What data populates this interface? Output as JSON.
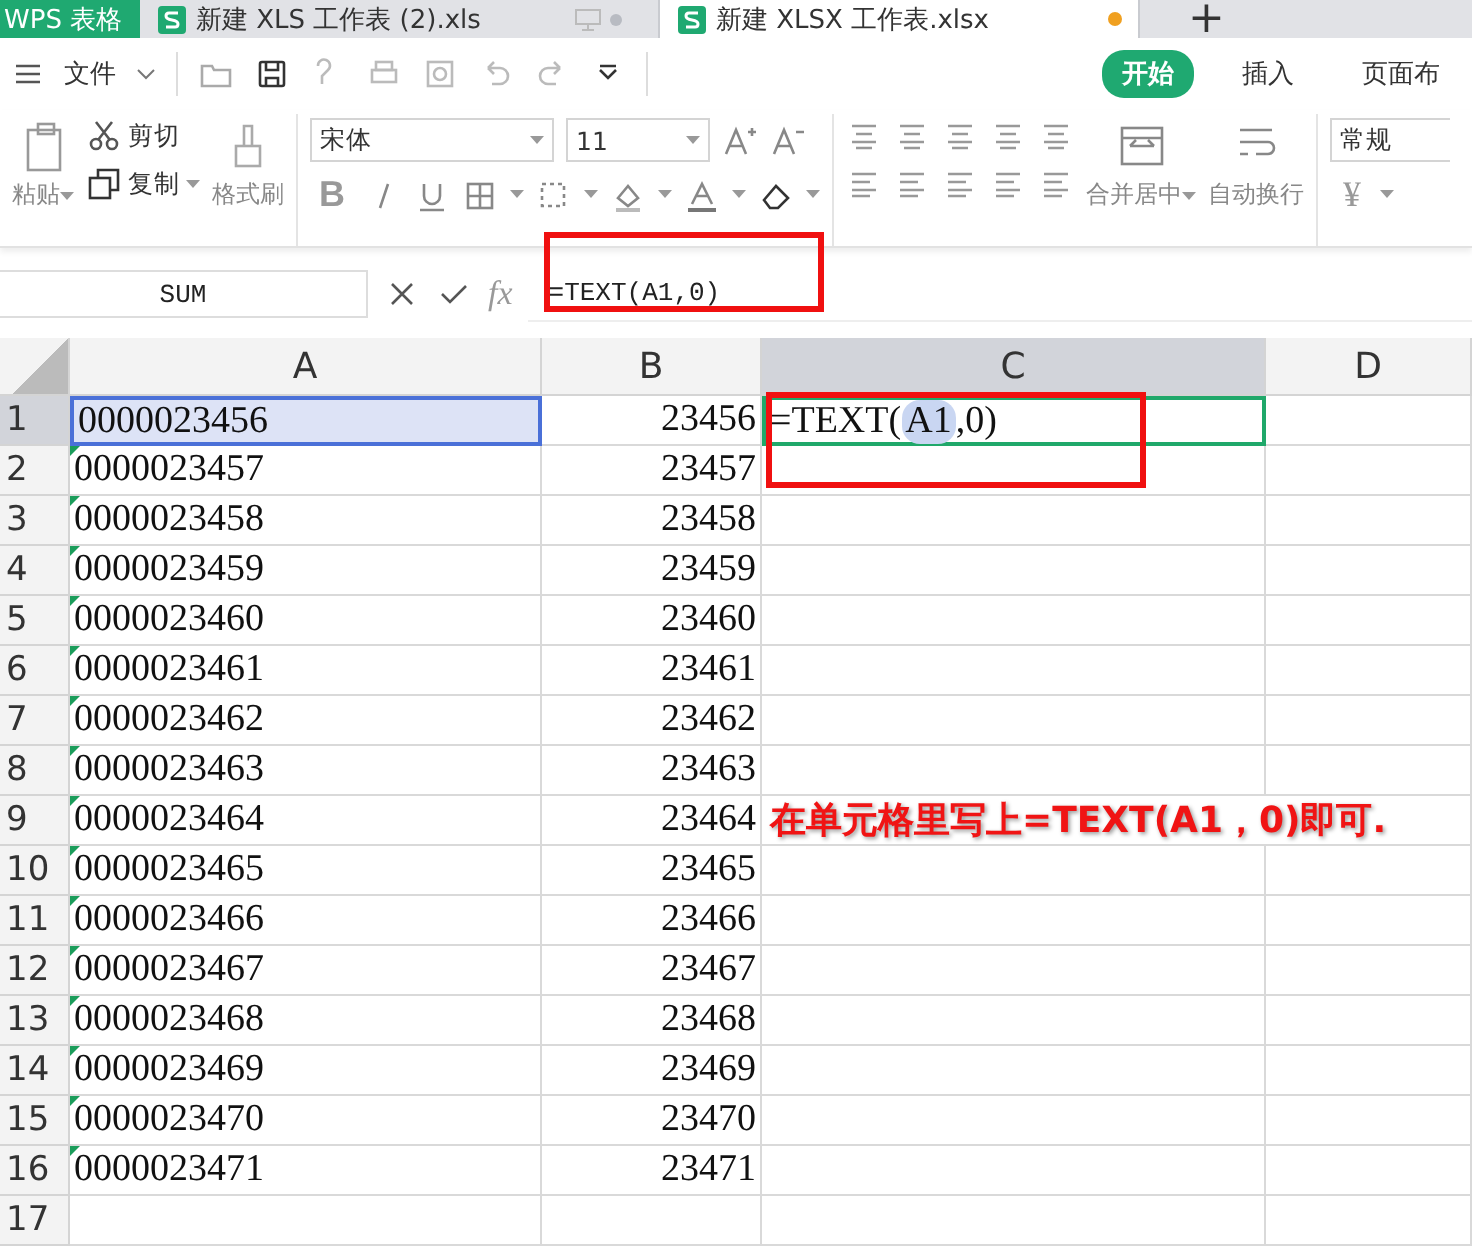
{
  "tabs": [
    {
      "label": "WPS 表格",
      "kind": "app",
      "selected": false
    },
    {
      "label": "新建 XLS 工作表 (2).xls",
      "kind": "doc",
      "selected": false,
      "unsaved": false
    },
    {
      "label": "新建 XLSX 工作表.xlsx",
      "kind": "doc",
      "selected": true,
      "unsaved": true
    },
    {
      "label": "+",
      "kind": "new"
    }
  ],
  "menu": {
    "file": "文件",
    "ribbon_tabs": [
      {
        "label": "开始",
        "selected": true
      },
      {
        "label": "插入",
        "selected": false
      },
      {
        "label": "页面布",
        "selected": false
      }
    ]
  },
  "ribbon": {
    "paste": "粘贴",
    "cut": "剪切",
    "copy": "复制",
    "format_painter": "格式刷",
    "font_name": "宋体",
    "font_size": "11",
    "merge": "合并居中",
    "wrap": "自动换行",
    "number_format": "常规",
    "currency": "¥",
    "bold": "B"
  },
  "formula_bar": {
    "name_box": "SUM",
    "function_label": "fx",
    "formula": "=TEXT(A1,0)"
  },
  "sheet": {
    "columns": [
      {
        "label": "A",
        "selected": false
      },
      {
        "label": "B",
        "selected": false
      },
      {
        "label": "C",
        "selected": true
      },
      {
        "label": "D",
        "selected": false
      }
    ],
    "rows": [
      {
        "n": "1",
        "a": "0000023456",
        "b": "23456",
        "flag": false,
        "selected": true
      },
      {
        "n": "2",
        "a": "0000023457",
        "b": "23457",
        "flag": true,
        "selected": false
      },
      {
        "n": "3",
        "a": "0000023458",
        "b": "23458",
        "flag": true,
        "selected": false
      },
      {
        "n": "4",
        "a": "0000023459",
        "b": "23459",
        "flag": true,
        "selected": false
      },
      {
        "n": "5",
        "a": "0000023460",
        "b": "23460",
        "flag": true,
        "selected": false
      },
      {
        "n": "6",
        "a": "0000023461",
        "b": "23461",
        "flag": true,
        "selected": false
      },
      {
        "n": "7",
        "a": "0000023462",
        "b": "23462",
        "flag": true,
        "selected": false
      },
      {
        "n": "8",
        "a": "0000023463",
        "b": "23463",
        "flag": true,
        "selected": false
      },
      {
        "n": "9",
        "a": "0000023464",
        "b": "23464",
        "flag": true,
        "selected": false
      },
      {
        "n": "10",
        "a": "0000023465",
        "b": "23465",
        "flag": true,
        "selected": false
      },
      {
        "n": "11",
        "a": "0000023466",
        "b": "23466",
        "flag": true,
        "selected": false
      },
      {
        "n": "12",
        "a": "0000023467",
        "b": "23467",
        "flag": true,
        "selected": false
      },
      {
        "n": "13",
        "a": "0000023468",
        "b": "23468",
        "flag": true,
        "selected": false
      },
      {
        "n": "14",
        "a": "0000023469",
        "b": "23469",
        "flag": true,
        "selected": false
      },
      {
        "n": "15",
        "a": "0000023470",
        "b": "23470",
        "flag": true,
        "selected": false
      },
      {
        "n": "16",
        "a": "0000023471",
        "b": "23471",
        "flag": true,
        "selected": false
      },
      {
        "n": "17",
        "a": "",
        "b": "",
        "flag": false,
        "selected": false
      }
    ],
    "editing_cell": {
      "prefix": "=TEXT(",
      "ref": "A1",
      "suffix": ",0)"
    }
  },
  "annotation": {
    "text": "在单元格里写上=TEXT(A1，0)即可."
  }
}
